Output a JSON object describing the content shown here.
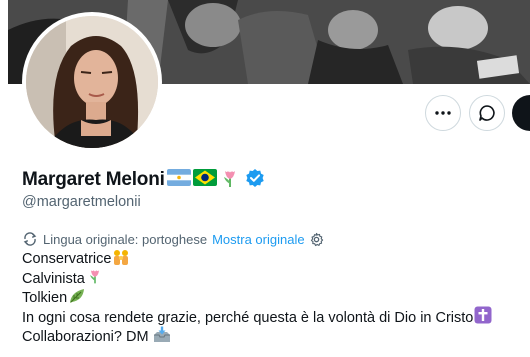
{
  "profile": {
    "display_name": "Margaret Meloni",
    "handle": "@margaretmelonii",
    "name_badges": [
      "argentina-flag-icon",
      "brazil-flag-icon",
      "tulip-icon",
      "verified-badge-icon"
    ]
  },
  "actions": {
    "more_icon": "more-icon",
    "message_icon": "message-icon"
  },
  "translation": {
    "original_language": "Lingua originale: portoghese",
    "show_original": "Mostra originale"
  },
  "bio": {
    "lines": [
      "Conservatrice",
      "Calvinista",
      "Tolkien",
      "In ogni cosa rendete grazie, perché questa è la volontà di Dio in Cristo",
      "Collaborazioni? DM"
    ]
  },
  "colors": {
    "link": "#1d9bf0",
    "secondary_text": "#536471",
    "verified": "#1d9bf0",
    "primary_text": "#0f1419"
  }
}
